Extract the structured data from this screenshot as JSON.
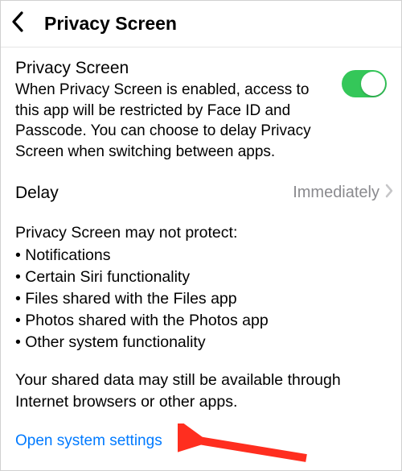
{
  "header": {
    "title": "Privacy Screen"
  },
  "privacy": {
    "title": "Privacy Screen",
    "description": "When Privacy Screen is enabled, access to this app will be restricted by Face ID and Passcode. You can choose to delay Privacy Screen when switching between apps.",
    "toggle_on": true
  },
  "delay": {
    "label": "Delay",
    "value": "Immediately"
  },
  "warning": {
    "intro": "Privacy Screen may not protect:",
    "items": [
      "Notifications",
      "Certain Siri functionality",
      "Files shared with the Files app",
      "Photos shared with the Photos app",
      "Other system functionality"
    ]
  },
  "shared_note": "Your shared data may still be available through Internet browsers or other apps.",
  "link_label": "Open system settings",
  "colors": {
    "toggle_green": "#34c759",
    "link_blue": "#007aff",
    "chevron_gray": "#c6c6c8",
    "annotation_red": "#ff3b30"
  }
}
